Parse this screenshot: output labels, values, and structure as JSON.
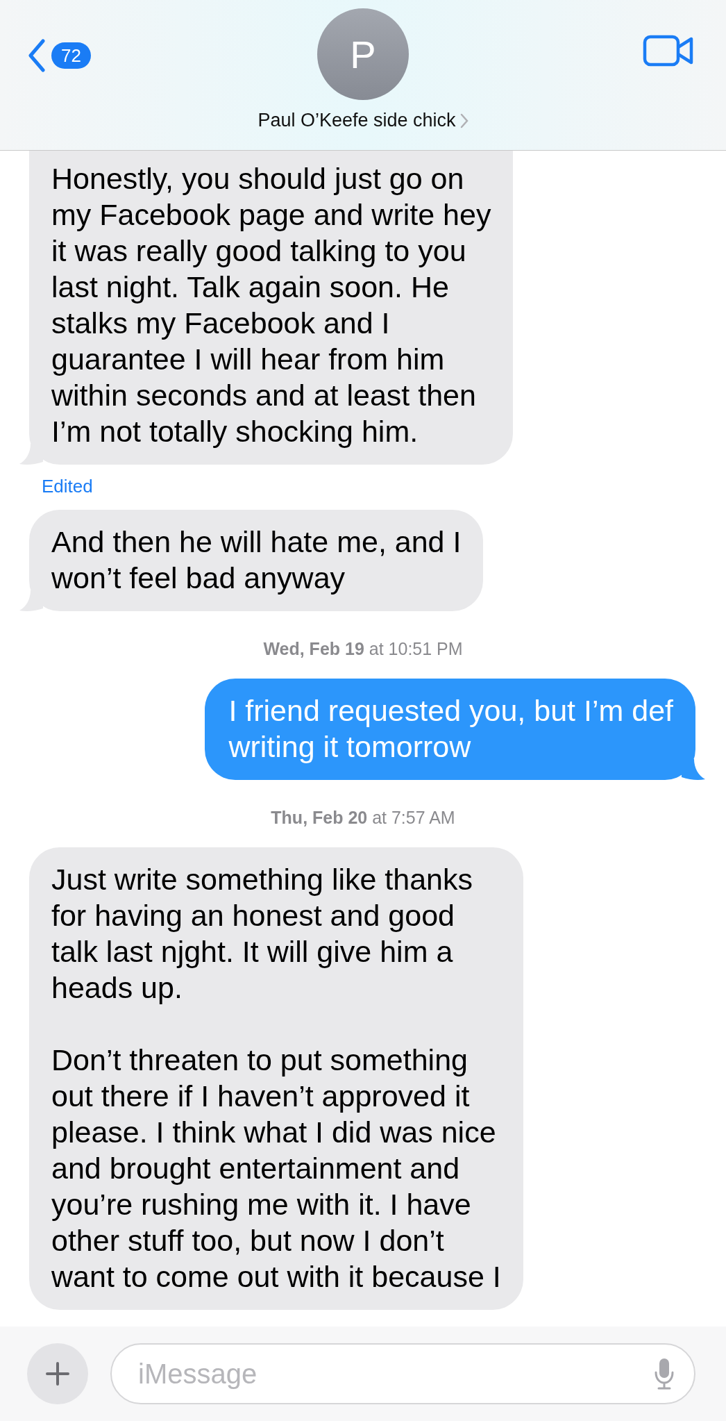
{
  "header": {
    "back_count": "72",
    "avatar_initial": "P",
    "contact_name": "Paul O’Keefe side chick"
  },
  "thread": [
    {
      "kind": "received",
      "tail": true,
      "text": "Honestly, you should just go on\nmy Facebook page and write hey\nit was really good talking to you\nlast night. Talk again soon. He\nstalks my Facebook and I\nguarantee I will hear from him\nwithin seconds and at least then\nI’m not totally shocking him."
    },
    {
      "kind": "edited",
      "text": "Edited"
    },
    {
      "kind": "received",
      "tail": true,
      "text": "And then he will hate me, and I\nwon’t feel bad anyway"
    },
    {
      "kind": "timestamp",
      "text": "**Wed, Feb 19** at 10:51 PM"
    },
    {
      "kind": "sent",
      "tail": true,
      "text": "I friend requested you, but I’m def\nwriting it tomorrow"
    },
    {
      "kind": "timestamp",
      "text": "**Thu, Feb 20** at 7:57 AM"
    },
    {
      "kind": "received",
      "tail": false,
      "text": "Just write something like thanks\nfor having an honest and good\ntalk last njght. It will give him a\nheads up.\n\nDon’t threaten to put something\nout there if I haven’t approved it\nplease. I think what I did was nice\nand brought entertainment and\nyou’re rushing me with it. I have\nother stuff too, but now I don’t\nwant to come out with it because I"
    }
  ],
  "composer": {
    "placeholder": "iMessage"
  }
}
